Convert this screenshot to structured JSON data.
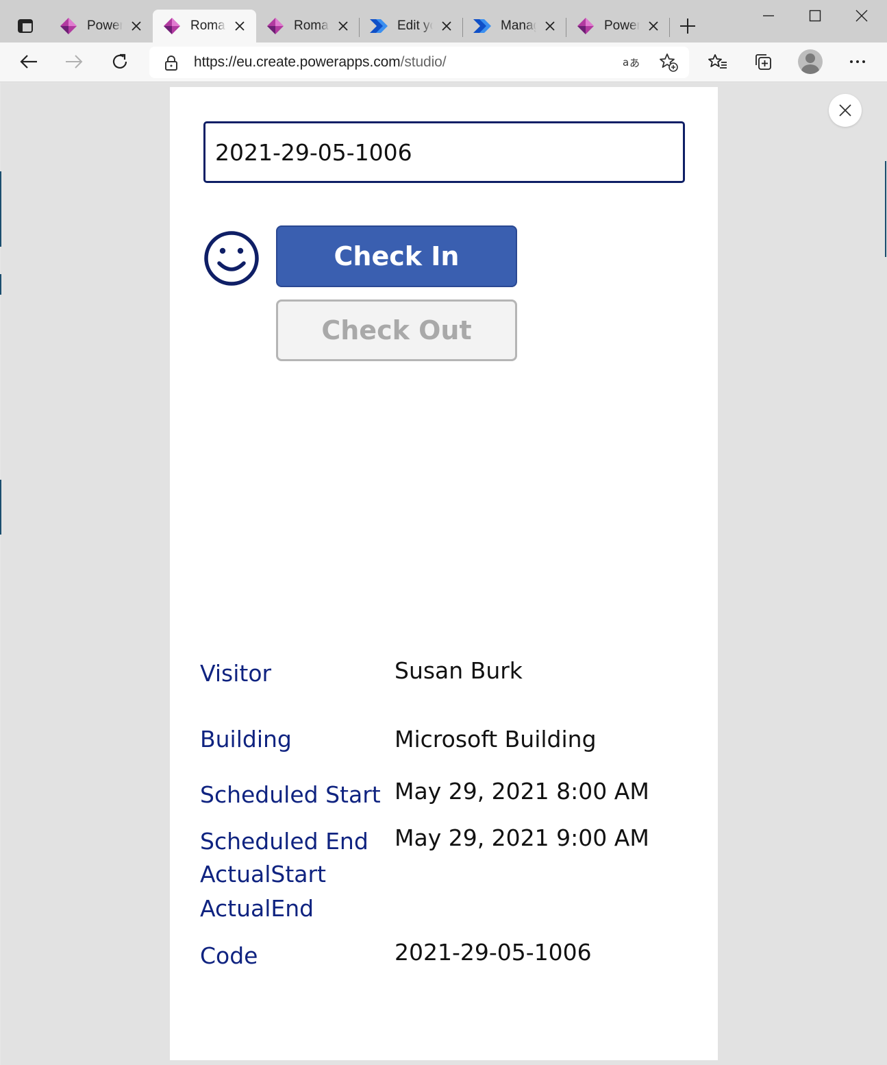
{
  "browser": {
    "tabs": [
      {
        "title": "Power Apps",
        "icon": "powerapps-icon",
        "active": false
      },
      {
        "title": "Roman",
        "icon": "powerapps-icon",
        "active": true
      },
      {
        "title": "Roman",
        "icon": "powerapps-icon",
        "active": false
      },
      {
        "title": "Edit your",
        "icon": "power-automate-icon",
        "active": false
      },
      {
        "title": "Manage",
        "icon": "power-automate-icon",
        "active": false
      },
      {
        "title": "Power Apps",
        "icon": "powerapps-icon",
        "active": false
      }
    ],
    "url_host": "https://eu.create.powerapps.com",
    "url_path": "/studio/",
    "colors": {
      "powerapps": "#8a2f8c",
      "automate": "#2a6ad8",
      "chrome_bg": "#cfcfcf"
    }
  },
  "app": {
    "code_value": "2021-29-05-1006",
    "check_in_label": "Check In",
    "check_out_label": "Check Out",
    "status_icon": "smiley-icon",
    "fields": {
      "visitor": {
        "label": "Visitor",
        "value": "Susan Burk"
      },
      "building": {
        "label": "Building",
        "value": "Microsoft Building"
      },
      "scheduled_start": {
        "label": "Scheduled Start",
        "value": "May 29, 2021 8:00 AM"
      },
      "scheduled_end": {
        "label": "Scheduled End",
        "value": "May 29, 2021 9:00 AM"
      },
      "actual_start": {
        "label": "ActualStart",
        "value": ""
      },
      "actual_end": {
        "label": "ActualEnd",
        "value": ""
      },
      "code": {
        "label": "Code",
        "value": "2021-29-05-1006"
      }
    },
    "colors": {
      "accent": "#3a5fb0",
      "label": "#0f2380",
      "input_border": "#0f1f66"
    }
  }
}
